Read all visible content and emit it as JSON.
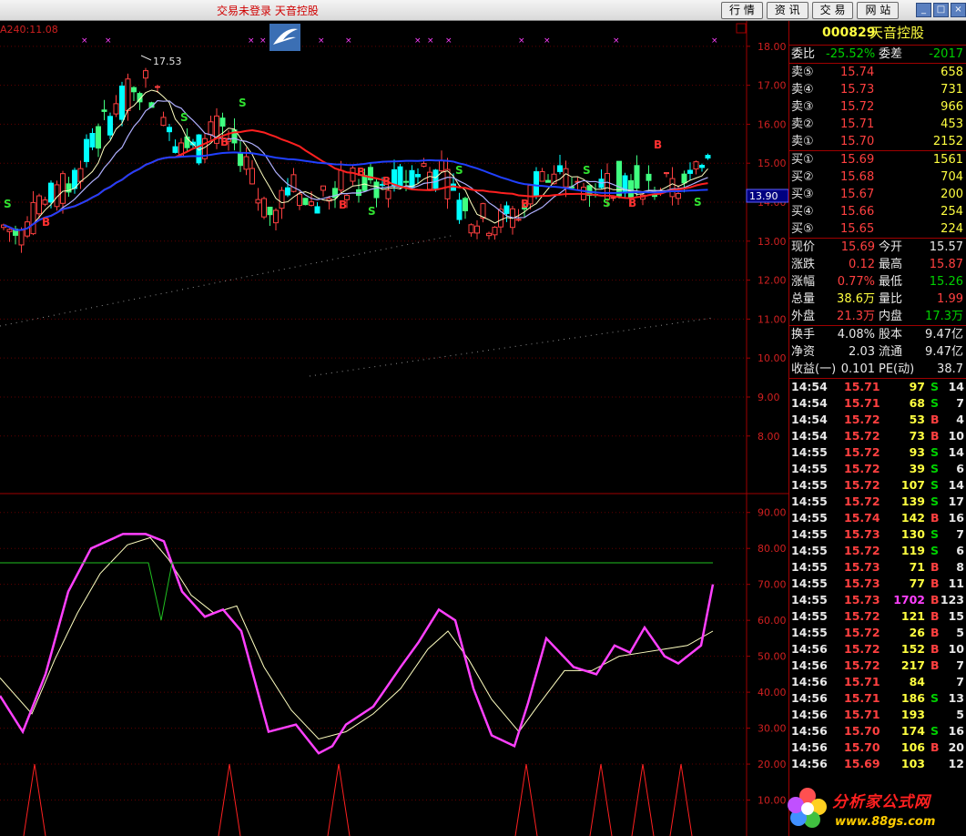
{
  "topbar": {
    "status": "交易未登录  天音控股",
    "buttons": [
      "行 情",
      "资 讯",
      "交 易",
      "网 站"
    ]
  },
  "chart": {
    "indicator_label": "A240:11.08",
    "high_label": "17.53",
    "current_price_tag": "13.90",
    "price_axis": [
      "18.00",
      "17.00",
      "16.00",
      "15.00",
      "14.00",
      "13.00",
      "12.00",
      "11.00",
      "10.00",
      "9.00",
      "8.00"
    ],
    "osc_axis": [
      "90.00",
      "80.00",
      "70.00",
      "60.00",
      "50.00",
      "40.00",
      "30.00",
      "20.00",
      "10.00"
    ],
    "signals": [
      "S",
      "B",
      "S",
      "B",
      "S",
      "B",
      "B",
      "S",
      "B",
      "S",
      "B",
      "S",
      "S",
      "B",
      "S",
      "B"
    ]
  },
  "chart_data": {
    "type": "candlestick",
    "price_ylim": [
      7.2,
      18.3
    ],
    "osc_ylim": [
      0,
      95
    ],
    "series": [
      {
        "name": "K",
        "color": "#ff40ff"
      },
      {
        "name": "D",
        "color": "#ffffc0"
      }
    ],
    "high": 17.53
  },
  "quote": {
    "code": "000829",
    "name": "天音控股",
    "webi_label": "委比",
    "webi": "-25.52%",
    "weicha_label": "委差",
    "weicha": "-2017",
    "asks": [
      {
        "label": "卖⑤",
        "price": "15.74",
        "vol": "658"
      },
      {
        "label": "卖④",
        "price": "15.73",
        "vol": "731"
      },
      {
        "label": "卖③",
        "price": "15.72",
        "vol": "966"
      },
      {
        "label": "卖②",
        "price": "15.71",
        "vol": "453"
      },
      {
        "label": "卖①",
        "price": "15.70",
        "vol": "2152"
      }
    ],
    "bids": [
      {
        "label": "买①",
        "price": "15.69",
        "vol": "1561"
      },
      {
        "label": "买②",
        "price": "15.68",
        "vol": "704"
      },
      {
        "label": "买③",
        "price": "15.67",
        "vol": "200"
      },
      {
        "label": "买④",
        "price": "15.66",
        "vol": "254"
      },
      {
        "label": "买⑤",
        "price": "15.65",
        "vol": "224"
      }
    ],
    "stats": [
      {
        "l1": "现价",
        "v1": "15.69",
        "c1": "red",
        "l2": "今开",
        "v2": "15.57",
        "c2": "white"
      },
      {
        "l1": "涨跌",
        "v1": "0.12",
        "c1": "red",
        "l2": "最高",
        "v2": "15.87",
        "c2": "red"
      },
      {
        "l1": "涨幅",
        "v1": "0.77%",
        "c1": "red",
        "l2": "最低",
        "v2": "15.26",
        "c2": "green"
      },
      {
        "l1": "总量",
        "v1": "38.6万",
        "c1": "yellow",
        "l2": "量比",
        "v2": "1.99",
        "c2": "red"
      },
      {
        "l1": "外盘",
        "v1": "21.3万",
        "c1": "red",
        "l2": "内盘",
        "v2": "17.3万",
        "c2": "green"
      }
    ],
    "stats2": [
      {
        "l1": "换手",
        "v1": "4.08%",
        "l2": "股本",
        "v2": "9.47亿"
      },
      {
        "l1": "净资",
        "v1": "2.03",
        "l2": "流通",
        "v2": "9.47亿"
      },
      {
        "l1": "收益(一)",
        "v1": "0.101",
        "l2": "PE(动)",
        "v2": "38.7"
      }
    ]
  },
  "ticks": [
    {
      "t": "14:54",
      "p": "15.71",
      "v": "97",
      "s": "S",
      "n": "14"
    },
    {
      "t": "14:54",
      "p": "15.71",
      "v": "68",
      "s": "S",
      "n": "7"
    },
    {
      "t": "14:54",
      "p": "15.72",
      "v": "53",
      "s": "B",
      "n": "4"
    },
    {
      "t": "14:54",
      "p": "15.72",
      "v": "73",
      "s": "B",
      "n": "10"
    },
    {
      "t": "14:55",
      "p": "15.72",
      "v": "93",
      "s": "S",
      "n": "14"
    },
    {
      "t": "14:55",
      "p": "15.72",
      "v": "39",
      "s": "S",
      "n": "6"
    },
    {
      "t": "14:55",
      "p": "15.72",
      "v": "107",
      "s": "S",
      "n": "14"
    },
    {
      "t": "14:55",
      "p": "15.72",
      "v": "139",
      "s": "S",
      "n": "17"
    },
    {
      "t": "14:55",
      "p": "15.74",
      "v": "142",
      "s": "B",
      "n": "16"
    },
    {
      "t": "14:55",
      "p": "15.73",
      "v": "130",
      "s": "S",
      "n": "7"
    },
    {
      "t": "14:55",
      "p": "15.72",
      "v": "119",
      "s": "S",
      "n": "6"
    },
    {
      "t": "14:55",
      "p": "15.73",
      "v": "71",
      "s": "B",
      "n": "8"
    },
    {
      "t": "14:55",
      "p": "15.73",
      "v": "77",
      "s": "B",
      "n": "11"
    },
    {
      "t": "14:55",
      "p": "15.73",
      "v": "1702",
      "s": "B",
      "n": "123"
    },
    {
      "t": "14:55",
      "p": "15.72",
      "v": "121",
      "s": "B",
      "n": "15"
    },
    {
      "t": "14:55",
      "p": "15.72",
      "v": "26",
      "s": "B",
      "n": "5"
    },
    {
      "t": "14:56",
      "p": "15.72",
      "v": "152",
      "s": "B",
      "n": "10"
    },
    {
      "t": "14:56",
      "p": "15.72",
      "v": "217",
      "s": "B",
      "n": "7"
    },
    {
      "t": "14:56",
      "p": "15.71",
      "v": "84",
      "s": "",
      "n": "7"
    },
    {
      "t": "14:56",
      "p": "15.71",
      "v": "186",
      "s": "S",
      "n": "13"
    },
    {
      "t": "14:56",
      "p": "15.71",
      "v": "193",
      "s": "",
      "n": "5"
    },
    {
      "t": "14:56",
      "p": "15.70",
      "v": "174",
      "s": "S",
      "n": "16"
    },
    {
      "t": "14:56",
      "p": "15.70",
      "v": "106",
      "s": "B",
      "n": "20"
    },
    {
      "t": "14:56",
      "p": "15.69",
      "v": "103",
      "s": "",
      "n": "12"
    }
  ],
  "watermark": {
    "name": "分析家公式网",
    "url": "www.88gs.com"
  },
  "colors": {
    "up": "#ff4040",
    "down": "#00ffff",
    "k": "#ff40ff",
    "d": "#ffffc0",
    "ma_red": "#ff2020",
    "ma_blue": "#2040ff"
  }
}
